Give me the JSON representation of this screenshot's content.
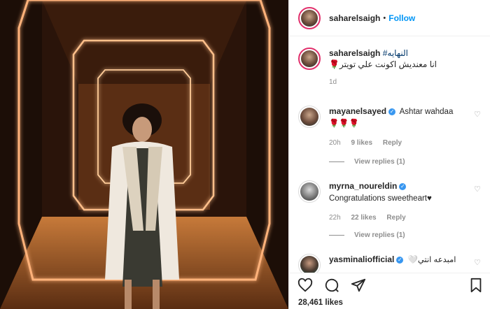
{
  "header": {
    "username": "saharelsaigh",
    "separator": "•",
    "follow_label": "Follow"
  },
  "caption": {
    "username": "saharelsaigh",
    "hashtag": "#النهايه",
    "text": "🌹انا معنديش اكونت علي تويتر",
    "time": "1d"
  },
  "comments": [
    {
      "username": "mayanelsayed",
      "text": "Ashtar wahdaa",
      "text2": "🌹🌹🌹",
      "time": "20h",
      "likes": "9 likes",
      "reply": "Reply",
      "view_replies": "View replies (1)"
    },
    {
      "username": "myrna_noureldin",
      "text": "Congratulations sweetheart♥",
      "time": "22h",
      "likes": "22 likes",
      "reply": "Reply",
      "view_replies": "View replies (1)"
    },
    {
      "username": "yasminaliofficial",
      "text": "🤍امبدعه انتي"
    }
  ],
  "likes_count": "28,461 likes",
  "icons": {
    "like": "heart-icon",
    "comment": "comment-icon",
    "share": "share-icon",
    "save": "bookmark-icon"
  },
  "colors": {
    "accent": "#0095f6",
    "verified": "#3897f0",
    "secondary_text": "#8e8e8e"
  }
}
